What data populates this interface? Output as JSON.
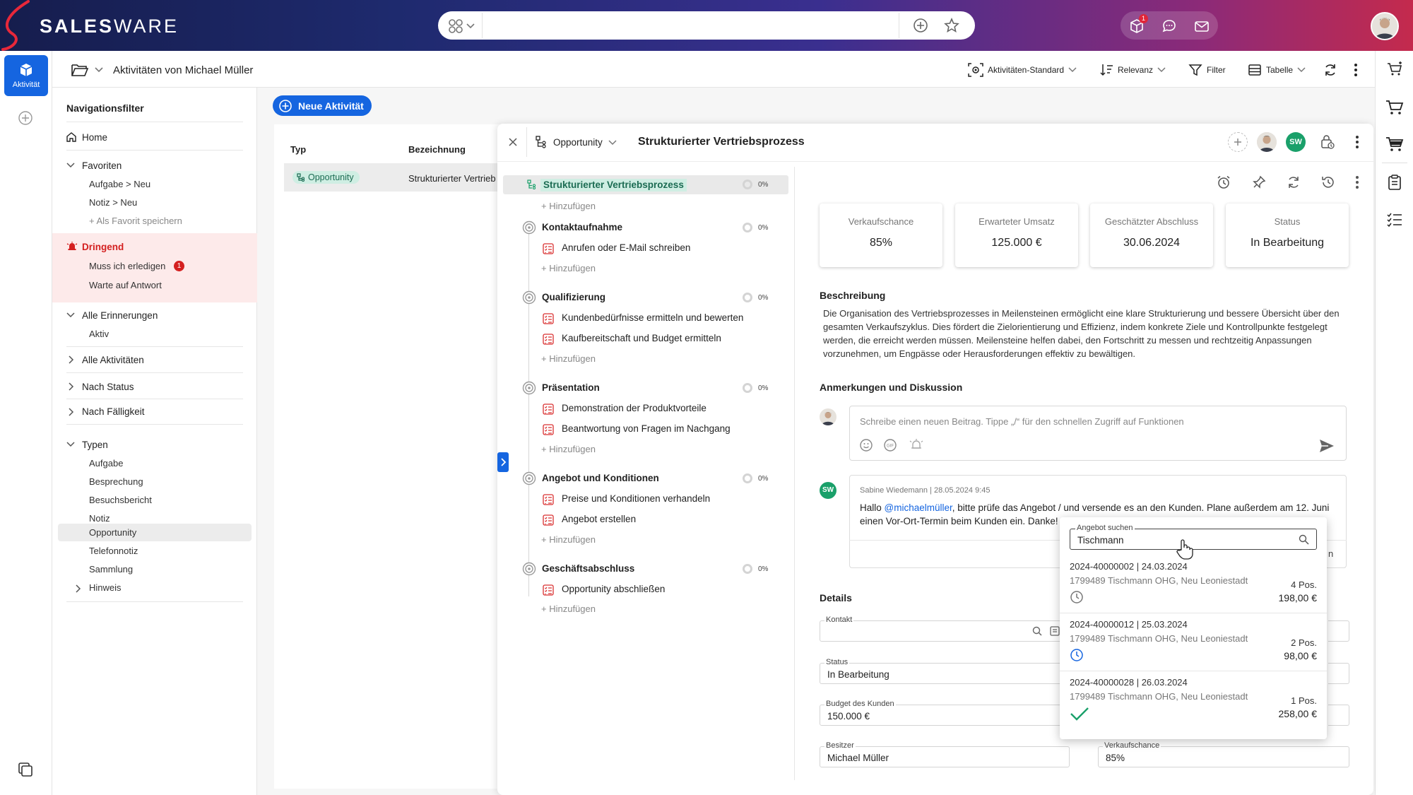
{
  "app": {
    "brand_bold": "SALES",
    "brand_light": "WARE",
    "notification_count": "1"
  },
  "rail": {
    "active_label": "Aktivität"
  },
  "header": {
    "title": "Aktivitäten von Michael Müller",
    "tools": [
      "Aktivitäten-Standard",
      "Relevanz",
      "Filter",
      "Tabelle"
    ]
  },
  "nav": {
    "title": "Navigationsfilter",
    "home": "Home",
    "favorites": {
      "label": "Favoriten",
      "items": [
        "Aufgabe > Neu",
        "Notiz > Neu"
      ],
      "save": "+ Als Favorit speichern"
    },
    "urgent": {
      "label": "Dringend",
      "items": [
        "Muss ich erledigen",
        "Warte auf Antwort"
      ],
      "badge": "1"
    },
    "reminders": {
      "label": "Alle Erinnerungen",
      "items": [
        "Aktiv"
      ]
    },
    "all_activities": "Alle Aktivitäten",
    "by_status": "Nach Status",
    "by_due": "Nach Fälligkeit",
    "types": {
      "label": "Typen",
      "items": [
        "Aufgabe",
        "Besprechung",
        "Besuchsbericht",
        "Notiz",
        "Opportunity",
        "Telefonnotiz",
        "Sammlung",
        "Hinweis"
      ]
    }
  },
  "new_activity": "Neue Aktivität",
  "list": {
    "col_type": "Typ",
    "col_name": "Bezeichnung",
    "row_type": "Opportunity",
    "row_name": "Strukturierter Vertrieb"
  },
  "detail": {
    "type_label": "Opportunity",
    "title": "Strukturierter Vertriebsprozess",
    "avatar_initials": "SW",
    "process": {
      "label": "Strukturierter Vertriebsprozess",
      "pct": "0%"
    },
    "add": "+ Hinzufügen",
    "milestones": [
      {
        "title": "Kontaktaufnahme",
        "pct": "0%",
        "tasks": [
          "Anrufen oder E-Mail schreiben"
        ]
      },
      {
        "title": "Qualifizierung",
        "pct": "0%",
        "tasks": [
          "Kundenbedürfnisse ermitteln und bewerten",
          "Kaufbereitschaft und Budget ermitteln"
        ]
      },
      {
        "title": "Präsentation",
        "pct": "0%",
        "tasks": [
          "Demonstration der Produktvorteile",
          "Beantwortung von Fragen im Nachgang"
        ]
      },
      {
        "title": "Angebot und Konditionen",
        "pct": "0%",
        "tasks": [
          "Preise und Konditionen verhandeln",
          "Angebot erstellen"
        ]
      },
      {
        "title": "Geschäftsabschluss",
        "pct": "0%",
        "tasks": [
          "Opportunity abschließen"
        ]
      }
    ],
    "cards": [
      {
        "label": "Verkaufschance",
        "value": "85%"
      },
      {
        "label": "Erwarteter Umsatz",
        "value": "125.000 €"
      },
      {
        "label": "Geschätzter Abschluss",
        "value": "30.06.2024"
      },
      {
        "label": "Status",
        "value": "In Bearbeitung"
      }
    ],
    "description_title": "Beschreibung",
    "description": "Die Organisation des Vertriebsprozesses in Meilensteinen ermöglicht eine klare Strukturierung und bessere Übersicht über den gesamten Verkaufszyklus. Dies fördert die Zielorientierung und Effizienz, indem konkrete Ziele und Kontrollpunkte festgelegt werden, die erreicht werden müssen. Meilensteine helfen dabei, den Fortschritt zu messen und rechtzeitig Anpassungen vorzunehmen, um Engpässe oder Herausforderungen effektiv zu bewältigen.",
    "discussion_title": "Anmerkungen und Diskussion",
    "comment_placeholder": "Schreibe einen neuen Beitrag. Tippe „/“ für den schnellen Zugriff auf Funktionen",
    "comment": {
      "meta": "Sabine Wiedemann | 28.05.2024 9:45",
      "prefix": "Hallo ",
      "mention": "@michaelmüller",
      "text_line1": ", bitte prüfe das Angebot / und versende es an den Kunden. Plane außerdem am 12. Juni",
      "text_line2": "einen Vor-Ort-Termin beim Kunden ein. Danke!"
    },
    "details_title": "Details",
    "fields": {
      "kontakt": {
        "label": "Kontakt",
        "value": ""
      },
      "status": {
        "label": "Status",
        "value": "In Bearbeitung"
      },
      "budget": {
        "label": "Budget des Kunden",
        "value": "150.000 €"
      },
      "besitzer": {
        "label": "Besitzer",
        "value": "Michael Müller"
      },
      "verkaufschance": {
        "label": "Verkaufschance",
        "value": "85%"
      }
    }
  },
  "popup": {
    "search_label": "Angebot suchen",
    "search_value": "Tischmann",
    "results": [
      {
        "id": "2024-40000002 | 24.03.2024",
        "customer": "1799489 Tischmann OHG, Neu Leoniestadt",
        "pos": "4 Pos.",
        "price": "198,00 €",
        "status_icon": "clock-icon-gray"
      },
      {
        "id": "2024-40000012  | 25.03.2024",
        "customer": "1799489 Tischmann OHG, Neu Leoniestadt",
        "pos": "2 Pos.",
        "price": "98,00 €",
        "status_icon": "clock-icon-blue"
      },
      {
        "id": "2024-40000028 | 26.03.2024",
        "customer": "1799489 Tischmann OHG, Neu Leoniestadt",
        "pos": "1 Pos.",
        "price": "258,00 €",
        "status_icon": "check-icon-green"
      }
    ]
  },
  "colors": {
    "primary": "#1565e0",
    "urgent": "#d42020",
    "success_green": "#1aa06a",
    "tag_bg": "#cfeee3"
  }
}
